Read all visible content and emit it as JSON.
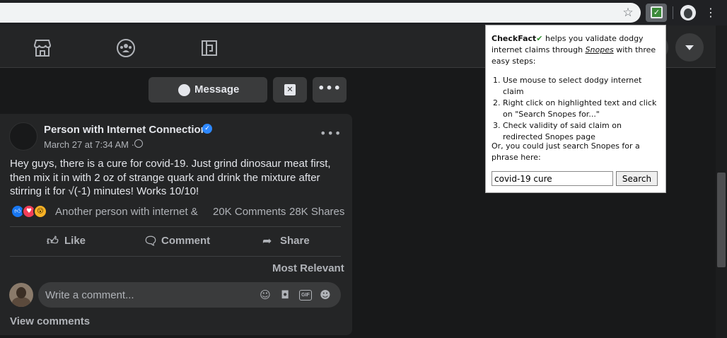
{
  "browser": {
    "extension_icon": "checkfact-checkbox-icon",
    "profile_icon": "profile-avatar",
    "menu_icon": "vertical-ellipsis-icon"
  },
  "fb_nav": {
    "icons": [
      "marketplace-icon",
      "groups-icon",
      "gaming-icon",
      "account-dropdown-chevron-icon"
    ]
  },
  "profile_actions": {
    "message_label": "Message",
    "x_icon": "close-square-icon",
    "more_icon": "more-horizontal-icon"
  },
  "post": {
    "author": "Person with Internet Connection",
    "timestamp": "March 27 at 7:34 AM ·",
    "text": "Hey guys, there is a cure for covid-19. Just grind dinosaur meat first, then mix it in with 2 oz of strange quark and drink the mixture after stirring it for √(-1) minutes! Works 10/10!",
    "reaction_names": "Another person with internet &",
    "comments_count": "20K Comments",
    "shares_count": "28K Shares",
    "actions": {
      "like": "Like",
      "comment": "Comment",
      "share": "Share"
    },
    "sort_label": "Most Relevant",
    "comment_placeholder": "Write a comment...",
    "gif_label": "GIF",
    "view_comments": "View comments"
  },
  "popup": {
    "brand": "CheckFact",
    "check_mark": "✔",
    "intro_part1": " helps you validate dodgy internet claims through ",
    "snopes": "Snopes",
    "intro_part2": " with three easy steps:",
    "steps": [
      "Use mouse to select dodgy internet claim",
      "Right click on highlighted text and click on \"Search Snopes for...\"",
      "Check validity of said claim on redirected Snopes page"
    ],
    "alt_text": "Or, you could just search Snopes for a phrase here:",
    "search_value": "covid-19 cure",
    "search_button": "Search"
  },
  "colors": {
    "fb_bg": "#18191a",
    "fb_card": "#242526",
    "fb_button": "#3a3b3c",
    "verified_blue": "#2d88ff",
    "like_blue": "#1877f2",
    "love_red": "#f33e58",
    "wow_yellow": "#f7b125"
  }
}
